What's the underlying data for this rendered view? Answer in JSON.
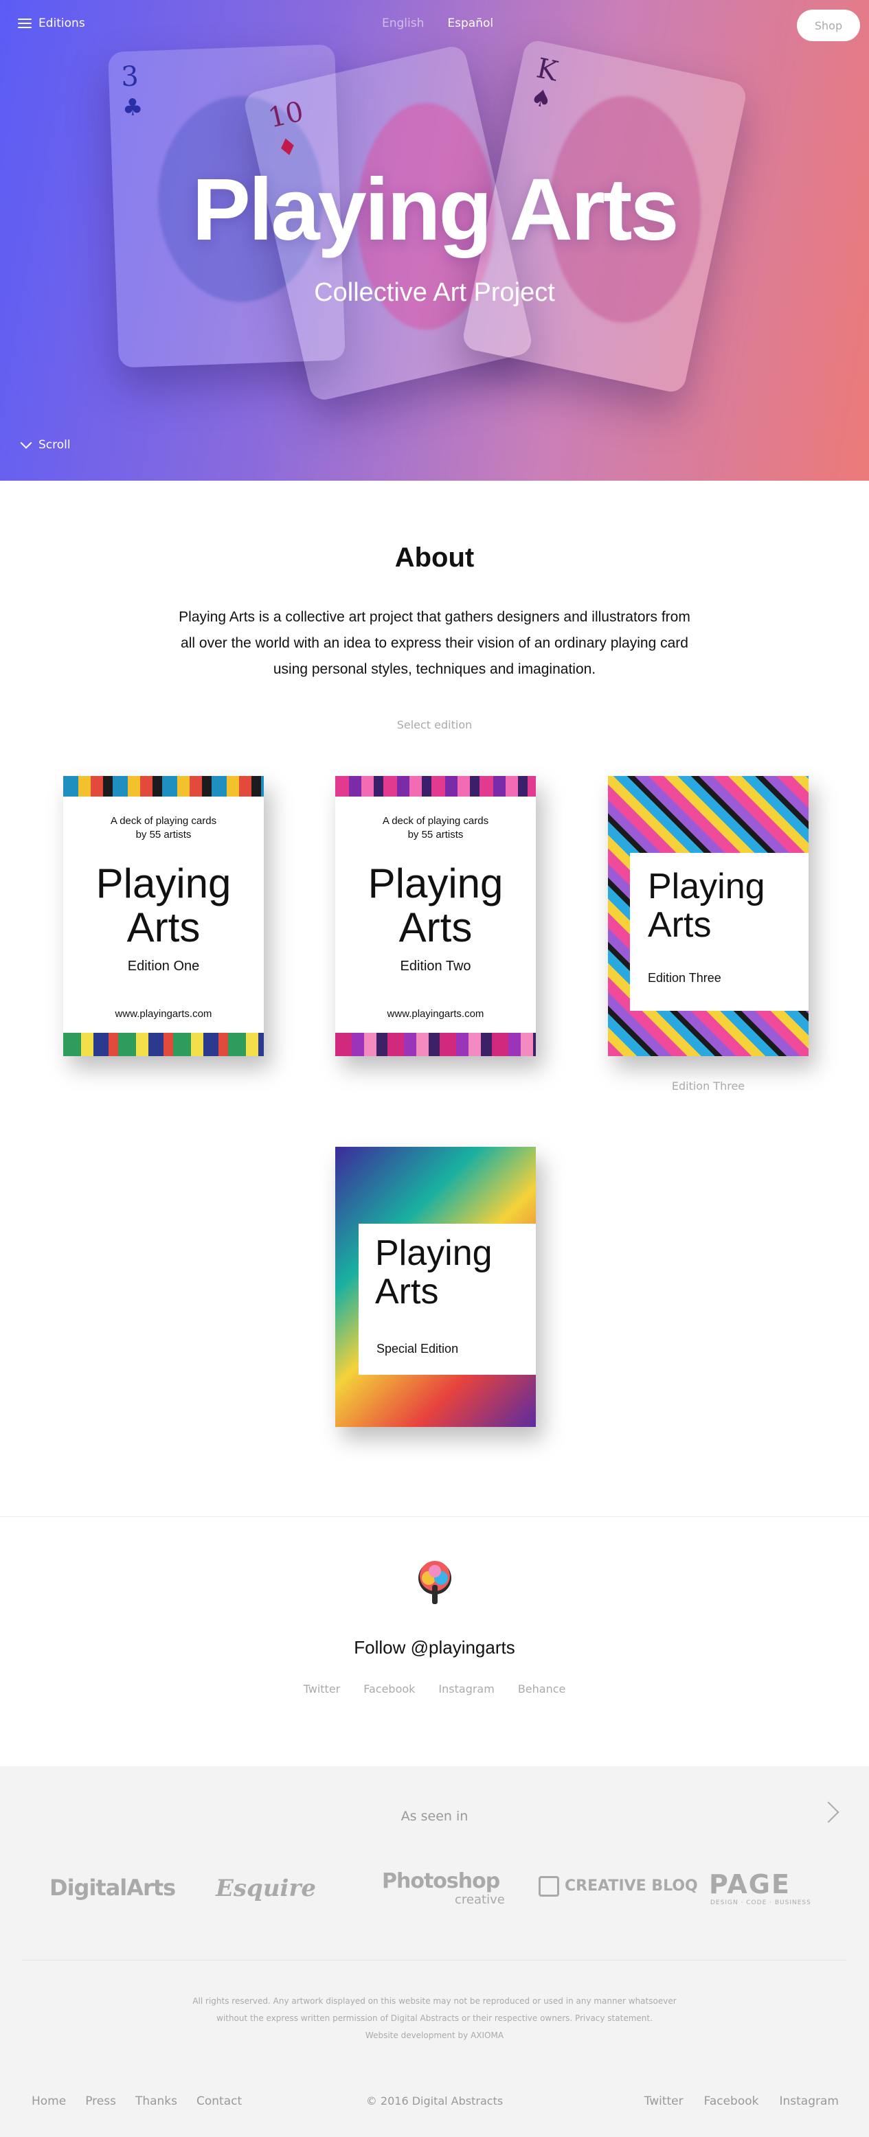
{
  "header": {
    "menu_label": "Editions",
    "languages": [
      "English",
      "Español"
    ],
    "active_language": "Español",
    "shop_label": "Shop"
  },
  "hero": {
    "title": "Playing Arts",
    "subtitle": "Collective Art Project",
    "scroll_label": "Scroll",
    "cards": [
      {
        "rank": "3",
        "suit": "♣"
      },
      {
        "rank": "10",
        "suit": "♦"
      },
      {
        "rank": "K",
        "suit": "♠"
      }
    ],
    "gradient_colors": [
      "#5b5cf6",
      "#ec7a78"
    ]
  },
  "about": {
    "title": "About",
    "text": "Playing Arts is a collective art project that gathers designers and illustrators from all over the world with an idea to express their vision of an ordinary playing card using personal styles, techniques and imagination.",
    "select_label": "Select edition"
  },
  "editions": [
    {
      "top_line1": "A deck of playing cards",
      "top_line2": "by 55 artists",
      "title_line1": "Playing",
      "title_line2": "Arts",
      "edition": "Edition One",
      "url": "www.playingarts.com"
    },
    {
      "top_line1": "A deck of playing cards",
      "top_line2": "by 55 artists",
      "title_line1": "Playing",
      "title_line2": "Arts",
      "edition": "Edition Two",
      "url": "www.playingarts.com"
    },
    {
      "title_line1": "Playing",
      "title_line2": "Arts",
      "edition": "Edition Three",
      "caption": "Edition Three"
    },
    {
      "title_line1": "Playing",
      "title_line2": "Arts",
      "edition": "Special Edition"
    }
  ],
  "follow": {
    "title": "Follow @playingarts",
    "links": [
      "Twitter",
      "Facebook",
      "Instagram",
      "Behance"
    ]
  },
  "footer": {
    "seen_in": "As seen in",
    "press_logos": [
      "DigitalArts",
      "Esquire",
      "Photoshop",
      "creative",
      "CREATIVE BLOQ",
      "PAGE",
      "DESIGN · CODE · BUSINESS"
    ],
    "legal_line1": "All rights reserved. Any artwork displayed on this website may not be reproduced or used in any manner whatsoever",
    "legal_line2": "without the express written permission of Digital Abstracts or their respective owners. Privacy statement.",
    "legal_line3": "Website development by AXIOMA",
    "nav": [
      "Home",
      "Press",
      "Thanks",
      "Contact"
    ],
    "copyright": "© 2016 Digital Abstracts",
    "social": [
      "Twitter",
      "Facebook",
      "Instagram"
    ]
  }
}
